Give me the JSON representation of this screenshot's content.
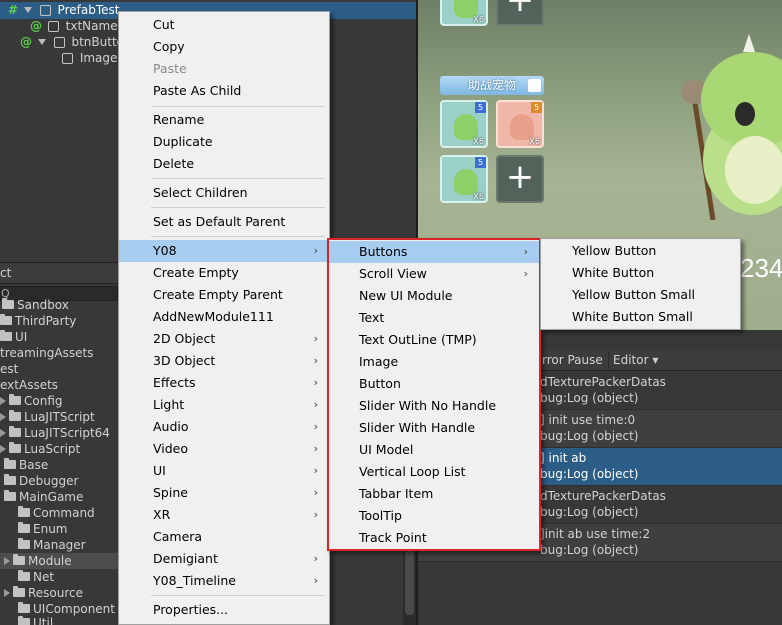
{
  "hierarchy": {
    "rows": [
      {
        "label": "PrefabTest",
        "prefix": "#",
        "selected": true
      },
      {
        "label": "txtName",
        "prefix": "@"
      },
      {
        "label": "btnButton",
        "prefix": "@"
      },
      {
        "label": "Image",
        "prefix": ""
      }
    ]
  },
  "project": {
    "tab_label": "ct",
    "search_placeholder": "Q",
    "items": [
      "Sandbox",
      "ThirdParty",
      "UI",
      "treamingAssets",
      "est",
      "extAssets",
      "Config",
      "LuaJITScript",
      "LuaJITScript64",
      "LuaScript",
      "Base",
      "Debugger",
      "MainGame",
      "Command",
      "Enum",
      "Manager",
      "Module",
      "Net",
      "Resource",
      "UIComponent",
      "Util"
    ]
  },
  "game": {
    "pet_bar_label": "助战宠物",
    "badge_count": "X6",
    "level": "5",
    "plus": "+",
    "big_number": "234"
  },
  "console": {
    "tabs": [
      "rror Pause",
      "Editor ▾"
    ],
    "rows": [
      {
        "line1": "dTexturePackerDatas",
        "line2": "bug:Log (object)"
      },
      {
        "line1": "] init use time:0",
        "line2": "bug:Log (object)"
      },
      {
        "line1": "] init ab",
        "line2": "bug:Log (object)",
        "selected": true
      },
      {
        "line1": "dTexturePackerDatas",
        "line2": "bug:Log (object)"
      },
      {
        "line1": "]init ab use time:2",
        "line2": "bug:Log (object)"
      }
    ]
  },
  "menu_main": {
    "items": [
      {
        "label": "Cut"
      },
      {
        "label": "Copy"
      },
      {
        "label": "Paste",
        "disabled": true
      },
      {
        "label": "Paste As Child"
      },
      {
        "label": "Rename"
      },
      {
        "label": "Duplicate"
      },
      {
        "label": "Delete"
      },
      {
        "label": "Select Children"
      },
      {
        "label": "Set as Default Parent"
      },
      {
        "label": "Y08",
        "submenu": true,
        "highlighted": true
      },
      {
        "label": "Create Empty"
      },
      {
        "label": "Create Empty Parent"
      },
      {
        "label": "AddNewModule111"
      },
      {
        "label": "2D Object",
        "submenu": true
      },
      {
        "label": "3D Object",
        "submenu": true
      },
      {
        "label": "Effects",
        "submenu": true
      },
      {
        "label": "Light",
        "submenu": true
      },
      {
        "label": "Audio",
        "submenu": true
      },
      {
        "label": "Video",
        "submenu": true
      },
      {
        "label": "UI",
        "submenu": true
      },
      {
        "label": "Spine",
        "submenu": true
      },
      {
        "label": "XR",
        "submenu": true
      },
      {
        "label": "Camera"
      },
      {
        "label": "Demigiant",
        "submenu": true
      },
      {
        "label": "Y08_Timeline",
        "submenu": true
      },
      {
        "label": "Properties..."
      }
    ]
  },
  "menu_y08": {
    "items": [
      {
        "label": "Buttons",
        "submenu": true,
        "highlighted": true
      },
      {
        "label": "Scroll View",
        "submenu": true
      },
      {
        "label": "New UI Module"
      },
      {
        "label": "Text"
      },
      {
        "label": "Text OutLine (TMP)"
      },
      {
        "label": "Image"
      },
      {
        "label": "Button"
      },
      {
        "label": "Slider With No Handle"
      },
      {
        "label": "Slider With Handle"
      },
      {
        "label": "UI Model"
      },
      {
        "label": "Vertical Loop List"
      },
      {
        "label": "Tabbar Item"
      },
      {
        "label": "ToolTip"
      },
      {
        "label": "Track Point"
      }
    ]
  },
  "menu_buttons": {
    "items": [
      {
        "label": "Yellow Button"
      },
      {
        "label": "White Button"
      },
      {
        "label": "Yellow Button Small"
      },
      {
        "label": "White Button Small"
      }
    ]
  },
  "submenu_arrow": "›",
  "colors": {
    "menu_bg": "#f0f0f0",
    "menu_highlight": "#a7cdf0",
    "selection_blue": "#2c5d87",
    "outline_red": "#d9262b",
    "editor_bg": "#383838"
  }
}
